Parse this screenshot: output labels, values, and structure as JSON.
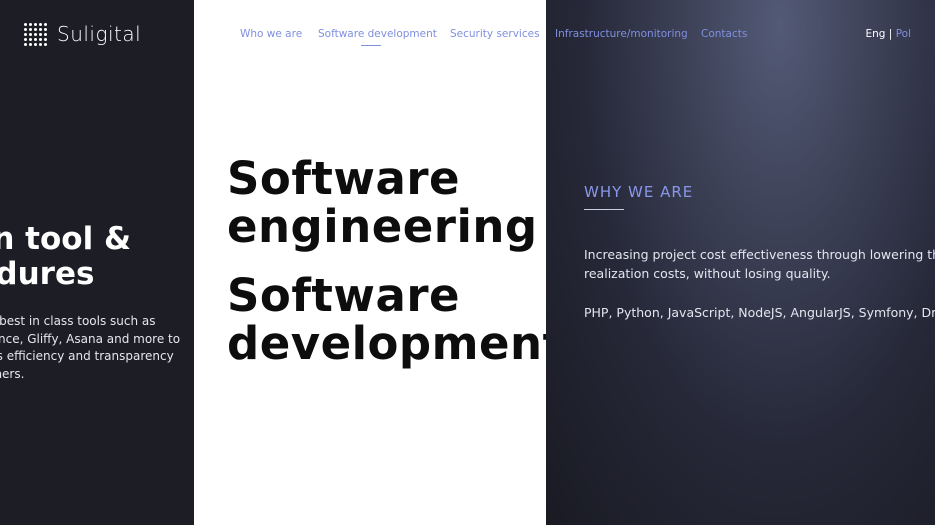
{
  "brand": {
    "name": "Suligital"
  },
  "nav": {
    "items": [
      {
        "label": "Who we are"
      },
      {
        "label": "Software development"
      },
      {
        "label": "Security services"
      },
      {
        "label": "Infrastructure/monitoring"
      },
      {
        "label": "Contacts"
      }
    ],
    "active_index": 1
  },
  "language": {
    "eng": "Eng",
    "separator": "|",
    "pol": "Pol"
  },
  "left_panel": {
    "heading": "ern tool &\ncedures",
    "text": "th best in class tools such as\nuence, Gliffy, Asana and more to\ness efficiency and transparency\nomers."
  },
  "middle_panel": {
    "heading_1": "Software\nengineering",
    "heading_2": "Software\ndevelopment"
  },
  "right_panel": {
    "title": "WHY WE ARE",
    "text": "Increasing project cost effectiveness through lowering the pro\nrealization costs, without losing quality.",
    "tech": "PHP, Python, JavaScript, NodeJS, AngularJS, Symfony, Drupa"
  },
  "colors": {
    "accent": "#7f8fe0",
    "dark_panel": "#1c1d25",
    "white_panel": "#ffffff"
  }
}
